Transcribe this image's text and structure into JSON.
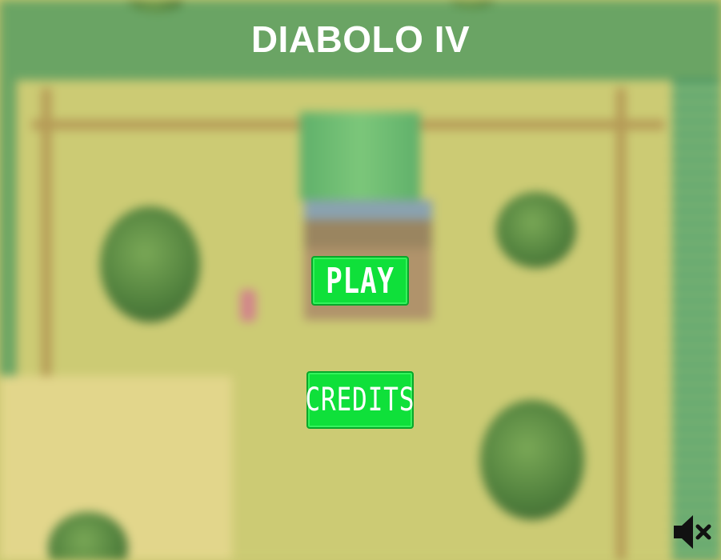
{
  "game": {
    "title": "DIABOLO IV"
  },
  "menu": {
    "play_label": "PLAY",
    "credits_label": "CREDITS"
  },
  "controls": {
    "mute_icon": "speaker-muted-icon"
  },
  "colors": {
    "button_green": "#0fe03a",
    "title_white": "#ffffff"
  }
}
